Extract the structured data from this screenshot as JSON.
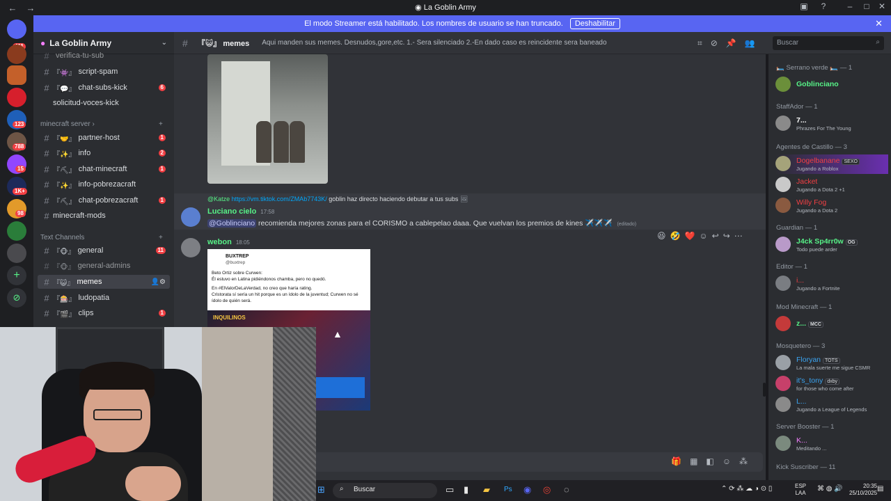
{
  "window": {
    "title": "La Goblin Army",
    "back": "←",
    "forward": "→"
  },
  "banner": {
    "text": "El modo Streamer está habilitado. Los nombres de usuario se han truncado.",
    "button": "Deshabilitar",
    "close": "✕"
  },
  "guilds": {
    "badges": [
      "411",
      "242",
      "123",
      "788",
      "15",
      "1K+",
      "98"
    ]
  },
  "server": {
    "name": "La Goblin Army",
    "chevron": "⌄"
  },
  "channels": [
    {
      "prefix": "",
      "name": "verifica-tu-sub",
      "count": ""
    },
    {
      "prefix": "『👾』",
      "name": "script-spam",
      "count": ""
    },
    {
      "prefix": "『💬』",
      "name": "chat-subs-kick",
      "count": "6"
    },
    {
      "prefix": "",
      "name": "solicitud-voces-kick",
      "count": ""
    }
  ],
  "categories": {
    "minecraft": "minecraft server",
    "text": "Text Channels"
  },
  "mc_channels": [
    {
      "prefix": "『🤝』",
      "name": "partner-host",
      "count": "1"
    },
    {
      "prefix": "『✨』",
      "name": "info",
      "count": "2"
    },
    {
      "prefix": "『⛏』",
      "name": "chat-minecraft",
      "count": "1"
    },
    {
      "prefix": "『✨』",
      "name": "info-pobrezacraft",
      "count": ""
    },
    {
      "prefix": "『⛏』",
      "name": "chat-pobrezacraft",
      "count": "1"
    },
    {
      "prefix": "",
      "name": "minecraft-mods",
      "count": ""
    }
  ],
  "text_channels": [
    {
      "prefix": "『🐵』",
      "name": "general",
      "count": "11"
    },
    {
      "prefix": "『🐵』",
      "name": "general-admins",
      "count": ""
    },
    {
      "prefix": "『😺』",
      "name": "memes",
      "count": ""
    },
    {
      "prefix": "『🎰』",
      "name": "ludopatia",
      "count": ""
    },
    {
      "prefix": "『🎬』",
      "name": "clips",
      "count": "1"
    }
  ],
  "topbar": {
    "channel": "『😺』 memes",
    "topic": "Aqui manden sus memes. Desnudos,gore,etc. 1.- Sera silenciado 2.-En dado caso es reincidente sera baneado",
    "search_placeholder": "Buscar"
  },
  "messages": {
    "reply": {
      "author": "@Katze",
      "link": "https://vm.tiktok.com/ZMAb7743K/",
      "text": "goblin haz directo haciendo debutar a tus subs"
    },
    "m1": {
      "author": "Luciano cielo",
      "time": "17:58",
      "mention": "@Goblinciano",
      "text": "recomienda mejores zonas para el CORISMO a cablepelao daaa. Que vuelvan los premios de kines ✈️✈️✈️",
      "edited": "(editado)"
    },
    "m2": {
      "author": "webon",
      "time": "18:05",
      "card_account": "BUXTREP",
      "card_handle": "@buxtrep",
      "card_line1": "Beto Ortiz sobre Curwen:",
      "card_line2": "Él estuvo en Latina pidiéndonos chamba, pero no quedó.",
      "card_line3": "En #ElValorDeLaVerdad, no creo que haría rating.",
      "card_line4": "Cristorata sí sería un hit porque es un ídolo de la juventud; Curwen no sé ídolo de quién será.",
      "card_video_label": "INQUILINOS"
    }
  },
  "members": {
    "groups": [
      {
        "title": "🛏️ Serrano verde 🛏️ — 1",
        "members": [
          {
            "name": "Goblinciano",
            "status": "",
            "color": "#57f287"
          }
        ]
      },
      {
        "title": "StaffAdor — 1",
        "members": [
          {
            "name": "7...",
            "status": "Phrazes For The Young",
            "color": "#ffffff"
          }
        ]
      },
      {
        "title": "Agentes de Castillo — 3",
        "members": [
          {
            "name": "Dogelbanane",
            "status": "Jugando a Roblox",
            "color": "#f23f43",
            "tag": "SEXO"
          },
          {
            "name": "Jacket",
            "status": "Jugando a Dota 2 +1",
            "color": "#f23f43"
          },
          {
            "name": "Willy Fog",
            "status": "Jugando a Dota 2",
            "color": "#f23f43"
          }
        ]
      },
      {
        "title": "Guardian — 1",
        "members": [
          {
            "name": "J4ck Sp4rr0w",
            "status": "Todo puede arder",
            "color": "#57f287",
            "tag": "OG"
          }
        ]
      },
      {
        "title": "Editor — 1",
        "members": [
          {
            "name": "i...",
            "status": "Jugando a Fortnite",
            "color": "#f23f43"
          }
        ]
      },
      {
        "title": "Mod Minecraft — 1",
        "members": [
          {
            "name": "z...",
            "status": "",
            "color": "#57f287",
            "tag": "MCC"
          }
        ]
      },
      {
        "title": "Mosquetero — 3",
        "members": [
          {
            "name": "Floryan",
            "status": "La mala suerte me sigue CSMR",
            "color": "#3ba5f3",
            "tag": "TOTS"
          },
          {
            "name": "it's_tony",
            "status": "for those who come after",
            "color": "#3ba5f3",
            "tag": "dxby"
          },
          {
            "name": "L...",
            "status": "Jugando a League of Legends",
            "color": "#3ba5f3"
          }
        ]
      },
      {
        "title": "Server Booster — 1",
        "members": [
          {
            "name": "K...",
            "status": "Meditando ...",
            "color": "#f47fff"
          }
        ]
      },
      {
        "title": "Kick Suscriber — 11",
        "members": []
      }
    ]
  },
  "taskbar": {
    "search": "Buscar",
    "lang1": "ESP",
    "lang2": "LAA",
    "time": "20:35",
    "date": "25/10/2025"
  },
  "colors": {
    "accent": "#5865f2",
    "online": "#23a559",
    "mention_badge": "#f23f43"
  }
}
